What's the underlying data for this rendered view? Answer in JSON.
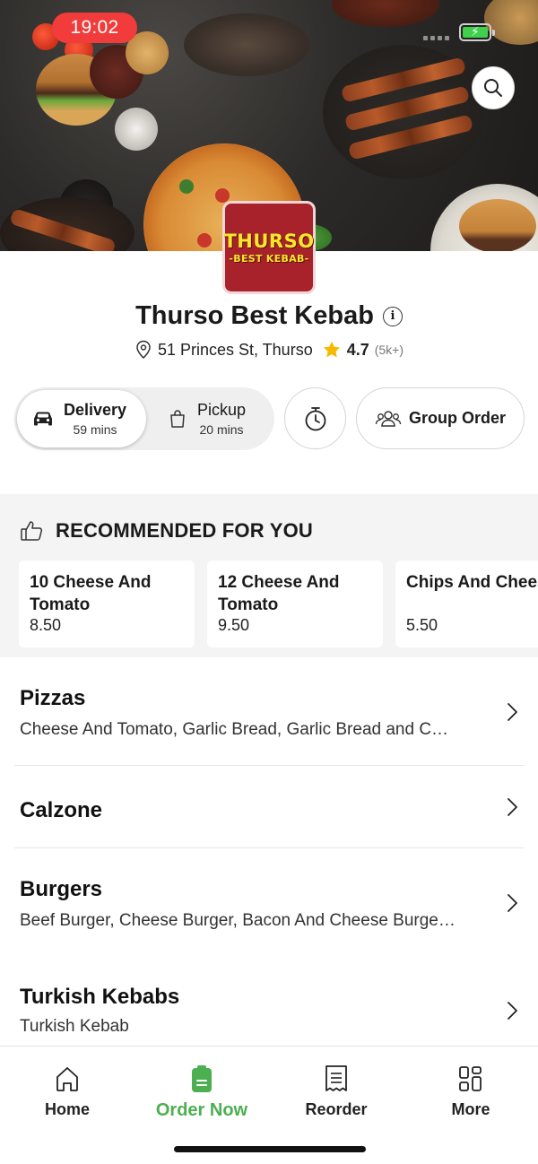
{
  "status_bar": {
    "time": "19:02"
  },
  "restaurant": {
    "name": "Thurso Best Kebab",
    "logo_line1": "THURSO",
    "logo_line2": "-BEST KEBAB-",
    "address": "51 Princes St, Thurso",
    "rating": "4.7",
    "rating_count": "(5k+)"
  },
  "order_modes": {
    "delivery": {
      "label": "Delivery",
      "time": "59 mins",
      "selected": true
    },
    "pickup": {
      "label": "Pickup",
      "time": "20 mins",
      "selected": false
    }
  },
  "group_order_label": "Group Order",
  "recommended": {
    "heading": "RECOMMENDED FOR YOU",
    "items": [
      {
        "name": "10 Cheese And Tomato",
        "price": "8.50"
      },
      {
        "name": "12 Cheese And Tomato",
        "price": "9.50"
      },
      {
        "name": "Chips And Cheese",
        "price": "5.50"
      }
    ]
  },
  "categories": [
    {
      "title": "Pizzas",
      "subtitle": "Cheese And Tomato, Garlic Bread, Garlic Bread and C…"
    },
    {
      "title": "Calzone",
      "subtitle": ""
    },
    {
      "title": "Burgers",
      "subtitle": "Beef Burger, Cheese Burger, Bacon And Cheese Burge…"
    },
    {
      "title": "Turkish Kebabs",
      "subtitle": "Turkish Kebab"
    }
  ],
  "bottom_nav": [
    {
      "label": "Home",
      "icon": "home-icon",
      "active": false
    },
    {
      "label": "Order Now",
      "icon": "order-icon",
      "active": true
    },
    {
      "label": "Reorder",
      "icon": "receipt-icon",
      "active": false
    },
    {
      "label": "More",
      "icon": "grid-icon",
      "active": false
    }
  ],
  "colors": {
    "accent_green": "#4caf50",
    "time_pill_red": "#f23b3b",
    "star_yellow": "#f6b800",
    "logo_red": "#a8222c",
    "logo_yellow": "#f5e82a"
  }
}
